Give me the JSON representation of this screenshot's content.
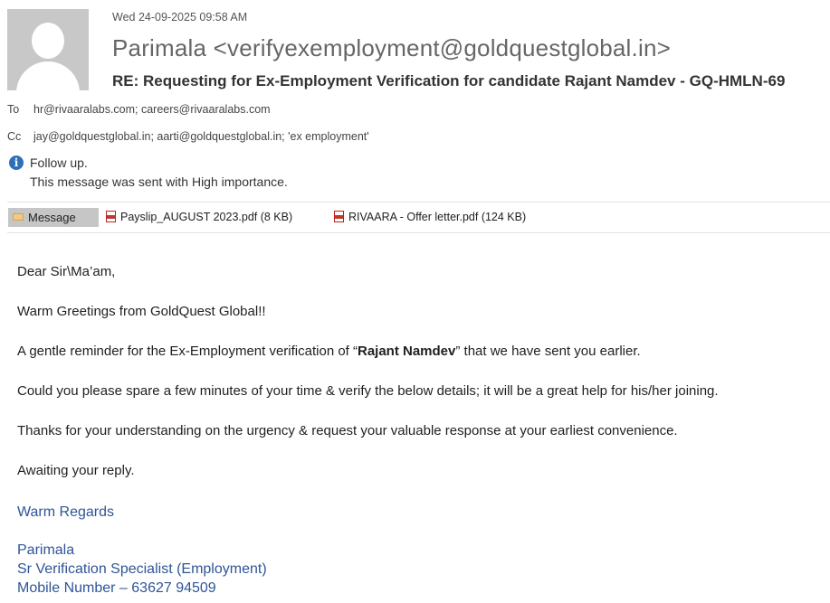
{
  "header": {
    "date": "Wed 24-09-2025 09:58 AM",
    "sender": "Parimala <verifyexemployment@goldquestglobal.in>",
    "subject": "RE: Requesting for Ex-Employment Verification for candidate Rajant Namdev - GQ-HMLN-69",
    "to_label": "To",
    "to_value": "hr@rivaaralabs.com; careers@rivaaralabs.com",
    "cc_label": "Cc",
    "cc_value": "jay@goldquestglobal.in; aarti@goldquestglobal.in; 'ex employment'",
    "info_line1": "Follow up.",
    "info_line2": "This message was sent with High importance."
  },
  "tabs": {
    "message_label": "Message",
    "attachments": [
      {
        "name": "Payslip_AUGUST 2023.pdf (8 KB)"
      },
      {
        "name": "RIVAARA - Offer letter.pdf (124 KB)"
      }
    ]
  },
  "body": {
    "greeting": "Dear Sir\\Ma’am,",
    "line1": "Warm Greetings from GoldQuest Global!!",
    "line2_pre": "A gentle reminder for the Ex-Employment verification of “",
    "line2_bold": "Rajant Namdev",
    "line2_post": "” that we have sent you earlier.",
    "line3": "Could you please spare a few minutes of your time & verify the below details; it will be a great help for his/her joining.",
    "line4": "Thanks for your understanding on the urgency & request your valuable response at your earliest convenience.",
    "line5": "Awaiting your reply."
  },
  "signature": {
    "closing": "Warm Regards",
    "name": "Parimala",
    "title": "Sr Verification Specialist (Employment)",
    "mobile": "Mobile Number – 63627 94509"
  },
  "colors": {
    "signature": "#2f5597",
    "info_icon": "#2f6fb8",
    "message_tab": "#c6c6c6"
  }
}
